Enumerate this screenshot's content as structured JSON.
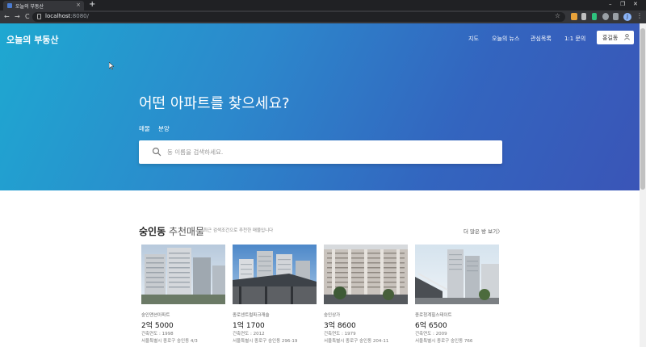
{
  "browser": {
    "tab_title": "오늘의 부동산",
    "tab_close": "×",
    "new_tab": "+",
    "url_host": "localhost",
    "url_port": ":8080/",
    "back": "←",
    "forward": "→",
    "reload": "C",
    "profile_initial": "J",
    "win_min": "–",
    "win_max": "❐",
    "win_close": "✕"
  },
  "header": {
    "brand": "오늘의 부동산",
    "nav": [
      "지도",
      "오늘의 뉴스",
      "관심목록",
      "1:1 문의"
    ],
    "login_label": "홍길동"
  },
  "hero": {
    "headline": "어떤 아파트를 찾으세요?",
    "tabs": [
      "매물",
      "분양"
    ],
    "search_placeholder": "동 이름을 검색하세요."
  },
  "listings": {
    "title_bold": "숭인동",
    "title_rest": " 추천매물",
    "subtitle": "최근 검색조건으로 추천한 매물입니다",
    "more": "더 많은 방 보기",
    "more_arrow": "〉",
    "items": [
      {
        "category": "숭인맨션아파트",
        "price": "2억 5000",
        "year": "건축연도 : 1998",
        "address": "서울특별시 종로구 숭인동 4/3"
      },
      {
        "category": "종로센트럴파크캐슬",
        "price": "1억 1700",
        "year": "건축연도 : 2012",
        "address": "서울특별시 종로구 숭인동 296-19"
      },
      {
        "category": "숭인상가",
        "price": "3억 8600",
        "year": "건축연도 : 1979",
        "address": "서울특별시 종로구 숭인동 204-11"
      },
      {
        "category": "종로청계힐스테이트",
        "price": "6억 6500",
        "year": "건축연도 : 2009",
        "address": "서울특별시 종로구 숭인동 766"
      }
    ]
  }
}
